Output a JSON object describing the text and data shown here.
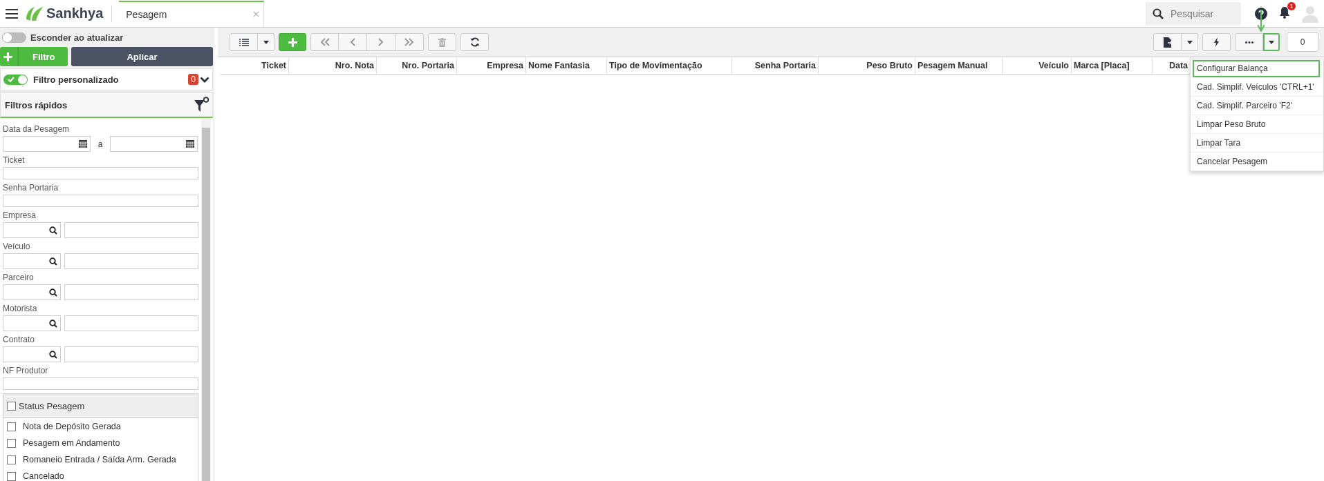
{
  "header": {
    "logo": "Sankhya",
    "tab": {
      "label": "Pesagem"
    },
    "search": {
      "placeholder": "Pesquisar"
    },
    "notifications": "1"
  },
  "filter_panel": {
    "hide_toggle": {
      "label": "Esconder ao atualizar",
      "on": false
    },
    "filter_button": "Filtro",
    "apply_button": "Aplicar",
    "custom_filter": {
      "label": "Filtro personalizado",
      "on": true,
      "count": "0"
    },
    "quick_filters": {
      "title": "Filtros rápidos",
      "fields": [
        {
          "kind": "date_range",
          "label": "Data da Pesagem",
          "separator": "a"
        },
        {
          "kind": "text",
          "label": "Ticket"
        },
        {
          "kind": "text",
          "label": "Senha Portaria"
        },
        {
          "kind": "lookup",
          "label": "Empresa"
        },
        {
          "kind": "lookup",
          "label": "Veículo"
        },
        {
          "kind": "lookup",
          "label": "Parceiro"
        },
        {
          "kind": "lookup",
          "label": "Motorista"
        },
        {
          "kind": "lookup",
          "label": "Contrato"
        },
        {
          "kind": "text",
          "label": "NF Produtor"
        }
      ],
      "status_group": {
        "label": "Status Pesagem",
        "checked": false,
        "options": [
          {
            "label": "Nota de Depósito Gerada",
            "checked": false
          },
          {
            "label": "Pesagem em Andamento",
            "checked": false
          },
          {
            "label": "Romaneio Entrada / Saída Arm. Gerada",
            "checked": false
          },
          {
            "label": "Cancelado",
            "checked": false
          }
        ]
      }
    }
  },
  "toolbar": {
    "record_count": "0"
  },
  "table": {
    "columns": [
      {
        "label": "Ticket"
      },
      {
        "label": "Nro. Nota"
      },
      {
        "label": "Nro. Portaria"
      },
      {
        "label": "Empresa"
      },
      {
        "label": "Nome Fantasia"
      },
      {
        "label": "Tipo de Movimentação"
      },
      {
        "label": "Senha Portaria"
      },
      {
        "label": "Peso Bruto"
      },
      {
        "label": "Pesagem Manual"
      },
      {
        "label": "Veículo"
      },
      {
        "label": "Marca [Placa]"
      },
      {
        "label": "Data"
      }
    ]
  },
  "actions_menu": {
    "items": [
      {
        "label": "Configurar Balança",
        "selected": true
      },
      {
        "label": "Cad. Simplif. Veículos 'CTRL+1'",
        "selected": false
      },
      {
        "label": "Cad. Simplif. Parceiro 'F2'",
        "selected": false
      },
      {
        "label": "Limpar Peso Bruto",
        "selected": false
      },
      {
        "label": "Limpar Tara",
        "selected": false
      },
      {
        "label": "Cancelar Pesagem",
        "selected": false
      }
    ]
  }
}
